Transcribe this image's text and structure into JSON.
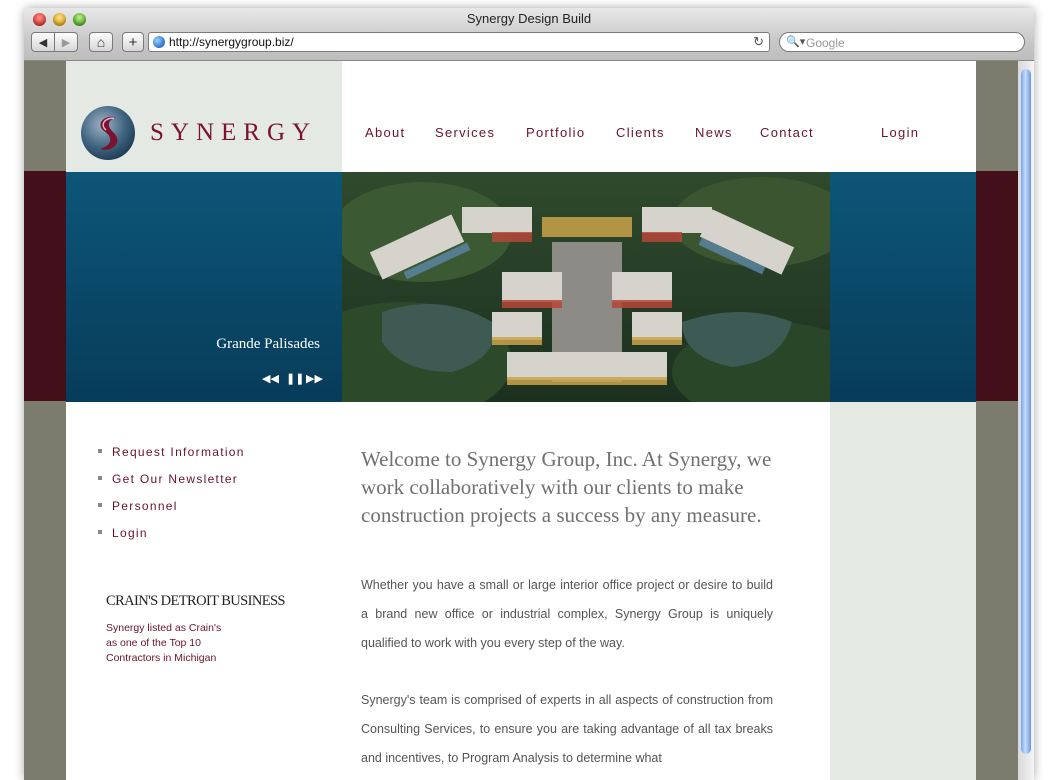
{
  "browser": {
    "window_title": "Synergy Design Build",
    "url": "http://synergygroup.biz/",
    "search_placeholder": "Google",
    "back": "◀",
    "forward": "▶",
    "home": "⌂",
    "add": "+",
    "reload": "↻",
    "search_glyph": "🔍▾"
  },
  "site": {
    "logo_text": "SYNERGY",
    "nav": [
      "About",
      "Services",
      "Portfolio",
      "Clients",
      "News",
      "Contact",
      "Login"
    ],
    "hero": {
      "caption": "Grande Palisades",
      "controls": [
        "◀◀",
        "❚❚",
        "▶▶"
      ]
    },
    "side_links": [
      "Request Information",
      "Get Our Newsletter",
      "Personnel",
      "Login"
    ],
    "crains": {
      "logo": "CRAIN'S DETROIT BUSINESS",
      "note_lines": [
        "Synergy listed as Crain's",
        "as one of the Top 10",
        "Contractors in Michigan"
      ]
    },
    "welcome": "Welcome to Synergy Group, Inc. At Synergy, we work collaboratively with our clients to make construction projects a success by any measure.",
    "paragraphs": [
      "Whether you have a small or large interior office project or desire to build a brand new office or industrial complex, Synergy Group is uniquely qualified to work with you every step of the way.",
      "Synergy's team is comprised of experts in all aspects of construction from Consulting Services, to ensure you are taking advantage of all tax breaks and incentives, to Program Analysis to determine what"
    ]
  },
  "colors": {
    "brand_maroon": "#7a1230",
    "hero_blue": "#0b4d6e",
    "band_dark_red": "#420f1b",
    "panel_sage": "#e5e9e4"
  }
}
